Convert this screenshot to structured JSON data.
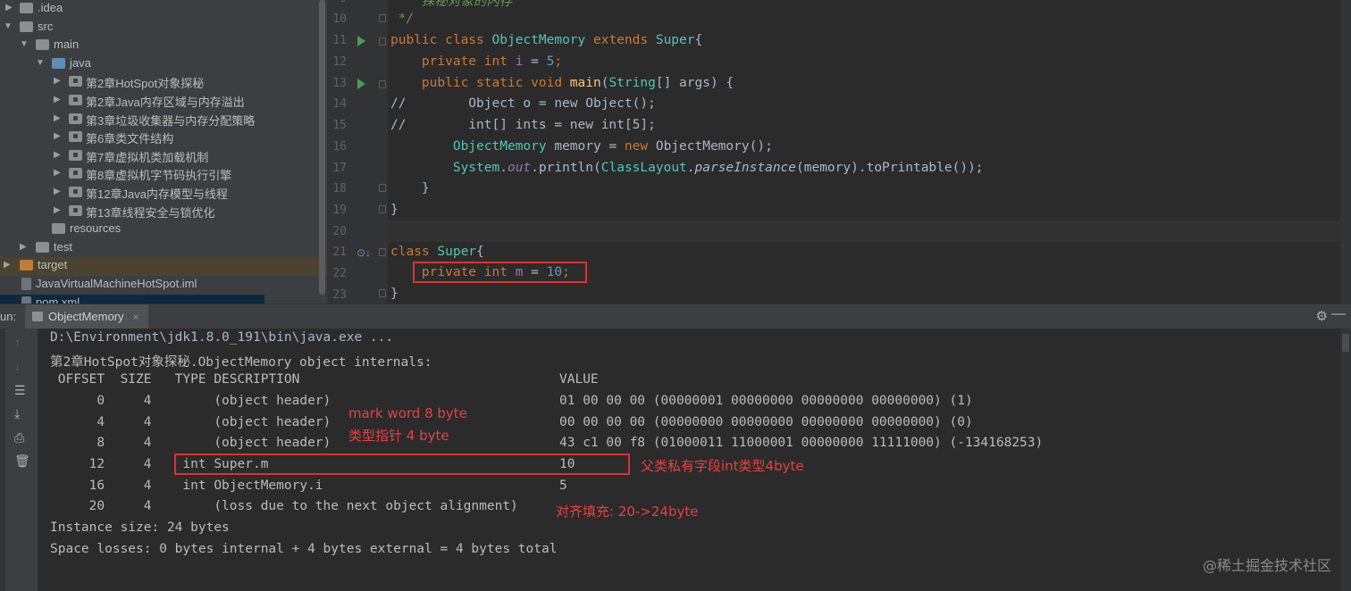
{
  "project_tree": {
    "items": [
      {
        "label": ".idea",
        "expanded": false,
        "icon": "folder-icon"
      },
      {
        "label": "src",
        "expanded": true,
        "icon": "folder-icon"
      },
      {
        "label": "main",
        "expanded": true,
        "icon": "folder-icon"
      },
      {
        "label": "java",
        "expanded": true,
        "icon": "source-folder-icon"
      },
      {
        "label": "第2章HotSpot对象探秘",
        "expanded": false,
        "icon": "package-icon"
      },
      {
        "label": "第2章Java内存区域与内存溢出",
        "expanded": false,
        "icon": "package-icon"
      },
      {
        "label": "第3章垃圾收集器与内存分配策略",
        "expanded": false,
        "icon": "package-icon"
      },
      {
        "label": "第6章类文件结构",
        "expanded": false,
        "icon": "package-icon"
      },
      {
        "label": "第7章虚拟机类加载机制",
        "expanded": false,
        "icon": "package-icon"
      },
      {
        "label": "第8章虚拟机字节码执行引擎",
        "expanded": false,
        "icon": "package-icon"
      },
      {
        "label": "第12章Java内存模型与线程",
        "expanded": false,
        "icon": "package-icon"
      },
      {
        "label": "第13章线程安全与锁优化",
        "expanded": false,
        "icon": "package-icon"
      },
      {
        "label": "resources",
        "icon": "resources-folder-icon"
      },
      {
        "label": "test",
        "expanded": false,
        "icon": "folder-icon"
      },
      {
        "label": "target",
        "expanded": false,
        "icon": "folder-icon"
      },
      {
        "label": "JavaVirtualMachineHotSpot.iml",
        "icon": "iml-file-icon"
      },
      {
        "label": "pom.xml",
        "icon": "maven-file-icon"
      }
    ]
  },
  "editor": {
    "line_numbers": [
      "9",
      "10",
      "11",
      "12",
      "13",
      "14",
      "15",
      "16",
      "17",
      "18",
      "19",
      "20",
      "21",
      "22",
      "23"
    ],
    "line9_comment": "    探秘对象的内存",
    "line10_comment": " */",
    "line11": {
      "kw1": "public class ",
      "cls": "ObjectMemory",
      "kw2": " extends ",
      "sup": "Super",
      "brace": "{"
    },
    "line12": {
      "kw": "    private int ",
      "fld": "i",
      "eq": " = ",
      "num": "5",
      "semi": ";"
    },
    "line13": {
      "kw": "    public static void ",
      "fn": "main",
      "p1": "(",
      "cls": "String",
      "rest": "[] args) {"
    },
    "line14": {
      "cmt": "//        Object o = new Object();"
    },
    "line15": {
      "cmt": "//        int[] ints = new int[5];"
    },
    "line16": {
      "indent": "        ",
      "cls": "ObjectMemory",
      "mid": " memory = ",
      "kw": "new ",
      "cls2": "ObjectMemory",
      "end": "();"
    },
    "line17": {
      "indent": "        ",
      "cls": "System",
      "dot": ".",
      "out": "out",
      "m": ".println(",
      "cls2": "ClassLayout",
      "dot2": ".",
      "fn": "parseInstance",
      "end": "(memory).toPrintable());"
    },
    "line18": "    }",
    "line19": "}",
    "line21": {
      "kw": "class ",
      "cls": "Super",
      "brace": "{"
    },
    "line22": {
      "indent": "    ",
      "kw": "private int ",
      "fld": "m",
      "eq": " = ",
      "num": "10",
      "semi": ";"
    },
    "line23": "}"
  },
  "run_panel": {
    "label": "un:",
    "tab_title": "ObjectMemory",
    "tab_close": "×",
    "settings_icon": "⚙",
    "minimize_icon": "—"
  },
  "console": {
    "command": "D:\\Environment\\jdk1.8.0_191\\bin\\java.exe ...",
    "internals_title": "第2章HotSpot对象探秘.ObjectMemory object internals:",
    "header": {
      "left": " OFFSET  SIZE   TYPE DESCRIPTION",
      "value": "VALUE"
    },
    "rows": [
      {
        "left": "      0     4        (object header)",
        "value": "01 00 00 00 (00000001 00000000 00000000 00000000) (1)"
      },
      {
        "left": "      4     4        (object header)",
        "value": "00 00 00 00 (00000000 00000000 00000000 00000000) (0)"
      },
      {
        "left": "      8     4        (object header)",
        "value": "43 c1 00 f8 (01000011 11000001 00000000 11111000) (-134168253)"
      },
      {
        "left": "     12     4    int Super.m",
        "value": "10"
      },
      {
        "left": "     16     4    int ObjectMemory.i",
        "value": "5"
      },
      {
        "left": "     20     4        (loss due to the next object alignment)",
        "value": ""
      }
    ],
    "instance_size": "Instance size: 24 bytes",
    "space_losses": "Space losses: 0 bytes internal + 4 bytes external = 4 bytes total"
  },
  "annotations": {
    "mark_word": "mark word 8 byte",
    "type_pointer": "类型指针 4 byte",
    "parent_field": "父类私有字段int类型4byte",
    "padding": "对齐填充: 20->24byte",
    "color": "#e84040"
  },
  "watermark": "@稀土掘金技术社区"
}
